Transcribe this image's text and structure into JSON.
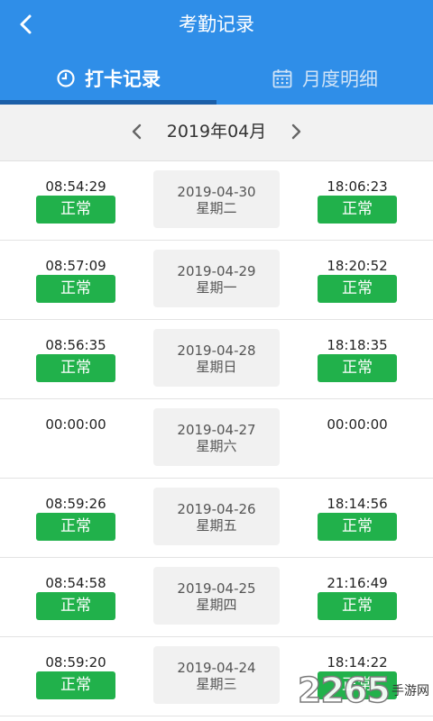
{
  "header": {
    "title": "考勤记录",
    "background_color": "#2f8ee8",
    "back_icon": "chevron-left-icon"
  },
  "tabs": [
    {
      "label": "打卡记录",
      "icon": "clock-icon",
      "active": true
    },
    {
      "label": "月度明细",
      "icon": "calendar-icon",
      "active": false
    }
  ],
  "month": {
    "label": "2019年04月",
    "prev_icon": "chevron-left-icon",
    "next_icon": "chevron-right-icon"
  },
  "status_color": "#21b14b",
  "records": [
    {
      "in_time": "08:54:29",
      "in_status": "正常",
      "date": "2019-04-30",
      "weekday": "星期二",
      "out_time": "18:06:23",
      "out_status": "正常"
    },
    {
      "in_time": "08:57:09",
      "in_status": "正常",
      "date": "2019-04-29",
      "weekday": "星期一",
      "out_time": "18:20:52",
      "out_status": "正常"
    },
    {
      "in_time": "08:56:35",
      "in_status": "正常",
      "date": "2019-04-28",
      "weekday": "星期日",
      "out_time": "18:18:35",
      "out_status": "正常"
    },
    {
      "in_time": "00:00:00",
      "in_status": "",
      "date": "2019-04-27",
      "weekday": "星期六",
      "out_time": "00:00:00",
      "out_status": ""
    },
    {
      "in_time": "08:59:26",
      "in_status": "正常",
      "date": "2019-04-26",
      "weekday": "星期五",
      "out_time": "18:14:56",
      "out_status": "正常"
    },
    {
      "in_time": "08:54:58",
      "in_status": "正常",
      "date": "2019-04-25",
      "weekday": "星期四",
      "out_time": "21:16:49",
      "out_status": "正常"
    },
    {
      "in_time": "08:59:20",
      "in_status": "正常",
      "date": "2019-04-24",
      "weekday": "星期三",
      "out_time": "18:14:22",
      "out_status": "正常"
    }
  ],
  "watermark": {
    "number": "2265",
    "text": "手游网"
  }
}
